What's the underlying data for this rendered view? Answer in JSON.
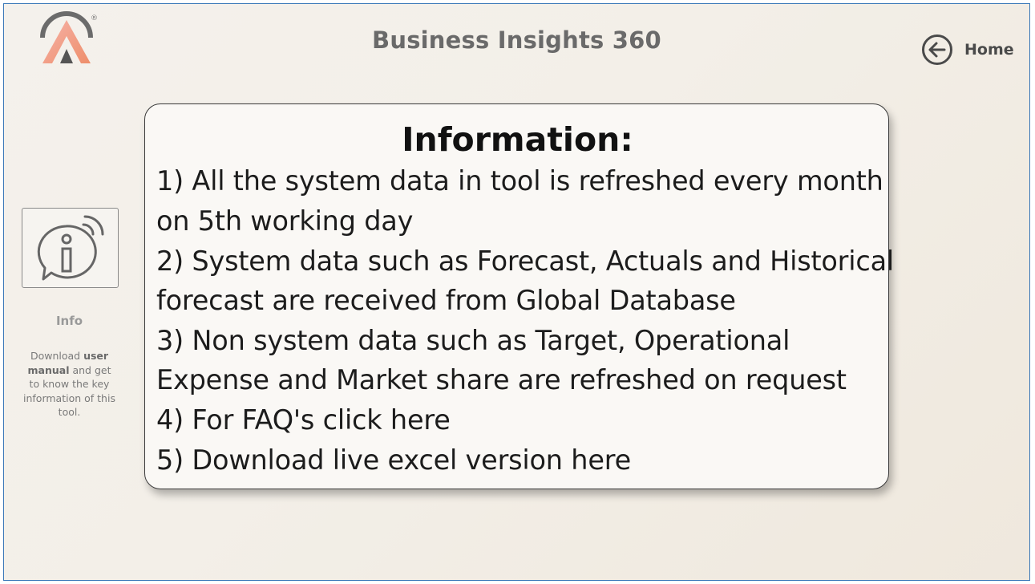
{
  "header": {
    "title": "Business Insights 360",
    "logo_icon": "atliq-logo-icon",
    "logo_mark": "®",
    "home_label": "Home",
    "home_icon": "back-arrow-circle-icon"
  },
  "sidebar": {
    "info_icon": "info-chat-icon",
    "info_label": "Info",
    "desc_part1": "Download ",
    "desc_bold": "user manual",
    "desc_part2": " and get to know the key information of this tool."
  },
  "card": {
    "title": "Information:",
    "lines": [
      "1) All the system data in tool is refreshed every month",
      "on 5th working day",
      "2) System data such as Forecast, Actuals and Historical",
      "forecast are received from Global Database",
      "3) Non system data such as Target, Operational",
      "Expense and Market share are refreshed on request",
      "4) For FAQ's click here",
      "5) Download live excel version here"
    ]
  },
  "colors": {
    "frame_border": "#3a78b8",
    "title_gray": "#6a6a6a",
    "logo_pink": "#f2a7a2",
    "logo_orange": "#f0956a"
  }
}
